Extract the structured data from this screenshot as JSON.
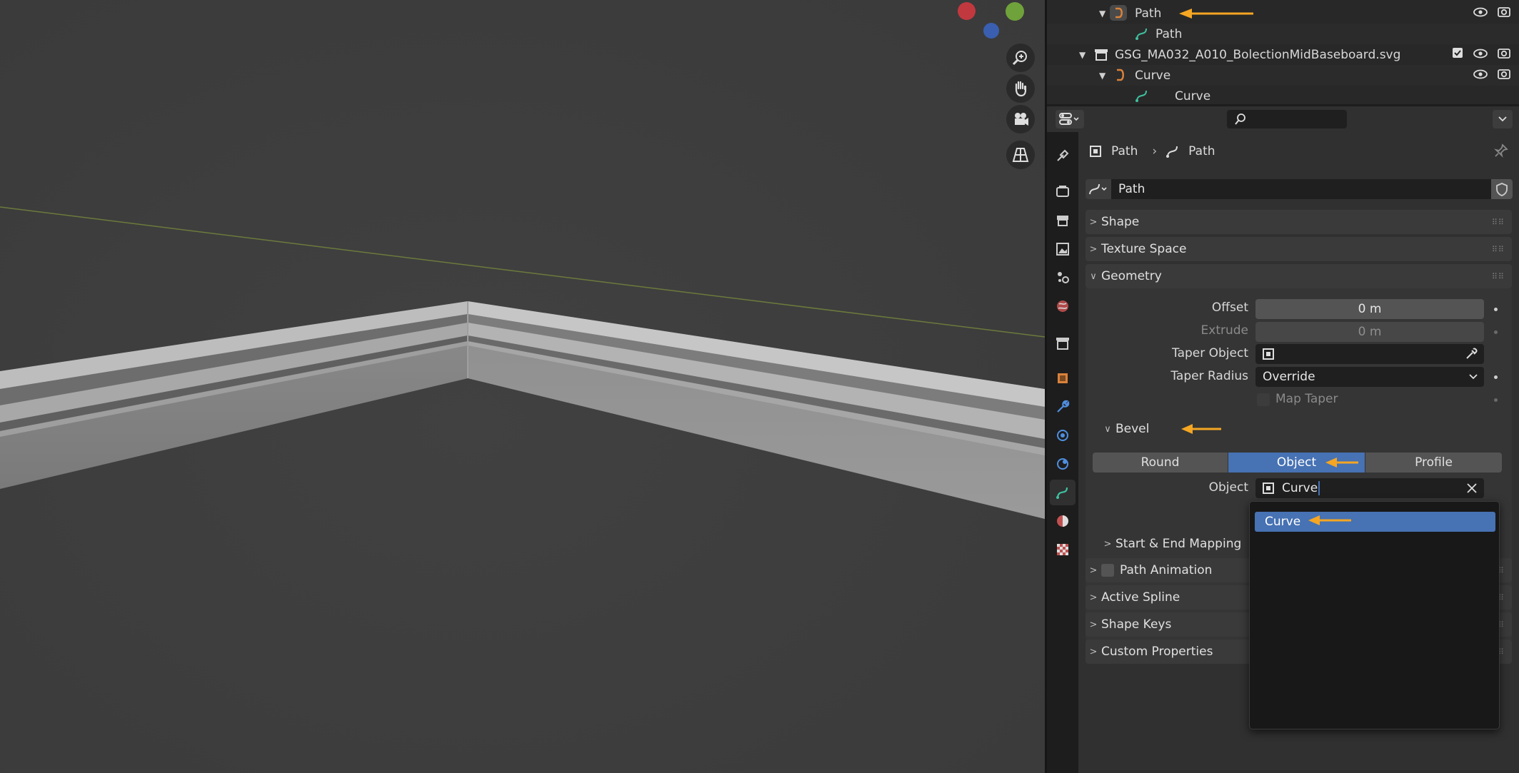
{
  "outliner": {
    "rows": [
      {
        "label": "Path",
        "kind": "object"
      },
      {
        "label": "Path",
        "kind": "data"
      },
      {
        "label": "GSG_MA032_A010_BolectionMidBaseboard.svg",
        "kind": "collection"
      },
      {
        "label": "Curve",
        "kind": "object"
      },
      {
        "label": "Curve",
        "kind": "data"
      }
    ]
  },
  "header": {
    "search_placeholder": ""
  },
  "breadcrumb": {
    "object": "Path",
    "data": "Path"
  },
  "datablock": {
    "name": "Path"
  },
  "panels": {
    "shape": "Shape",
    "texture_space": "Texture Space",
    "geometry": "Geometry",
    "start_end_mapping": "Start & End Mapping",
    "path_animation": "Path Animation",
    "active_spline": "Active Spline",
    "shape_keys": "Shape Keys",
    "custom_properties": "Custom Properties"
  },
  "geometry": {
    "offset_label": "Offset",
    "offset_value": "0 m",
    "extrude_label": "Extrude",
    "extrude_value": "0 m",
    "taper_object_label": "Taper Object",
    "taper_radius_label": "Taper Radius",
    "taper_radius_value": "Override",
    "map_taper_label": "Map Taper"
  },
  "bevel": {
    "title": "Bevel",
    "modes": [
      "Round",
      "Object",
      "Profile"
    ],
    "active_mode": "Object",
    "object_label": "Object",
    "object_value": "Curve"
  },
  "dropdown": {
    "items": [
      "Curve"
    ]
  },
  "colors": {
    "accent": "#4772b3",
    "annotation_arrow": "#f5a623",
    "curve_data": "#3fc1a0",
    "object_orange": "#d9823b"
  }
}
